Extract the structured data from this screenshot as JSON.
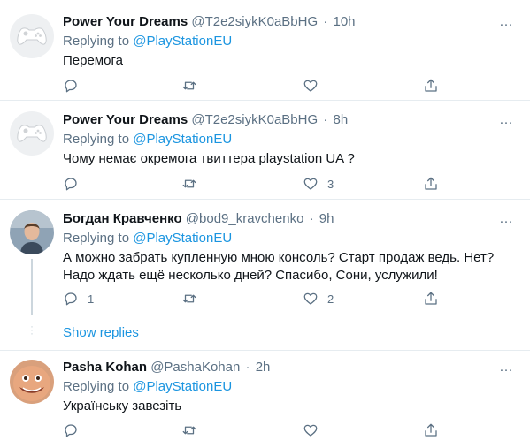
{
  "tweets": [
    {
      "name": "Power Your Dreams",
      "handle": "@T2e2siykK0aBbHG",
      "sep": "·",
      "time": "10h",
      "replying_prefix": "Replying to",
      "replying_to": "@PlayStationEU",
      "text": "Перемога",
      "counts": {
        "reply": "",
        "retweet": "",
        "like": ""
      },
      "avatar": "gamepad-avatar"
    },
    {
      "name": "Power Your Dreams",
      "handle": "@T2e2siykK0aBbHG",
      "sep": "·",
      "time": "8h",
      "replying_prefix": "Replying to",
      "replying_to": "@PlayStationEU",
      "text": "Чому немає окремога твиттера playstation UA ?",
      "counts": {
        "reply": "",
        "retweet": "",
        "like": "3"
      },
      "avatar": "gamepad-avatar"
    },
    {
      "name": "Богдан Кравченко",
      "handle": "@bod9_kravchenko",
      "sep": "·",
      "time": "9h",
      "replying_prefix": "Replying to",
      "replying_to": "@PlayStationEU",
      "text": "А можно забрать купленную мною консоль? Старт продаж ведь. Нет? Надо ждать ещё несколько дней? Спасибо, Сони, услужили!",
      "counts": {
        "reply": "1",
        "retweet": "",
        "like": "2"
      },
      "avatar": "person-avatar"
    },
    {
      "name": "Pasha Kohan",
      "handle": "@PashaKohan",
      "sep": "·",
      "time": "2h",
      "replying_prefix": "Replying to",
      "replying_to": "@PlayStationEU",
      "text": "Українську завезіть",
      "counts": {
        "reply": "",
        "retweet": "",
        "like": ""
      },
      "avatar": "face-avatar"
    }
  ],
  "show_replies": "Show replies",
  "more_icon": "…",
  "colors": {
    "link": "#1b95e0",
    "muted": "#5b7083",
    "divider": "#e6ecf0"
  }
}
